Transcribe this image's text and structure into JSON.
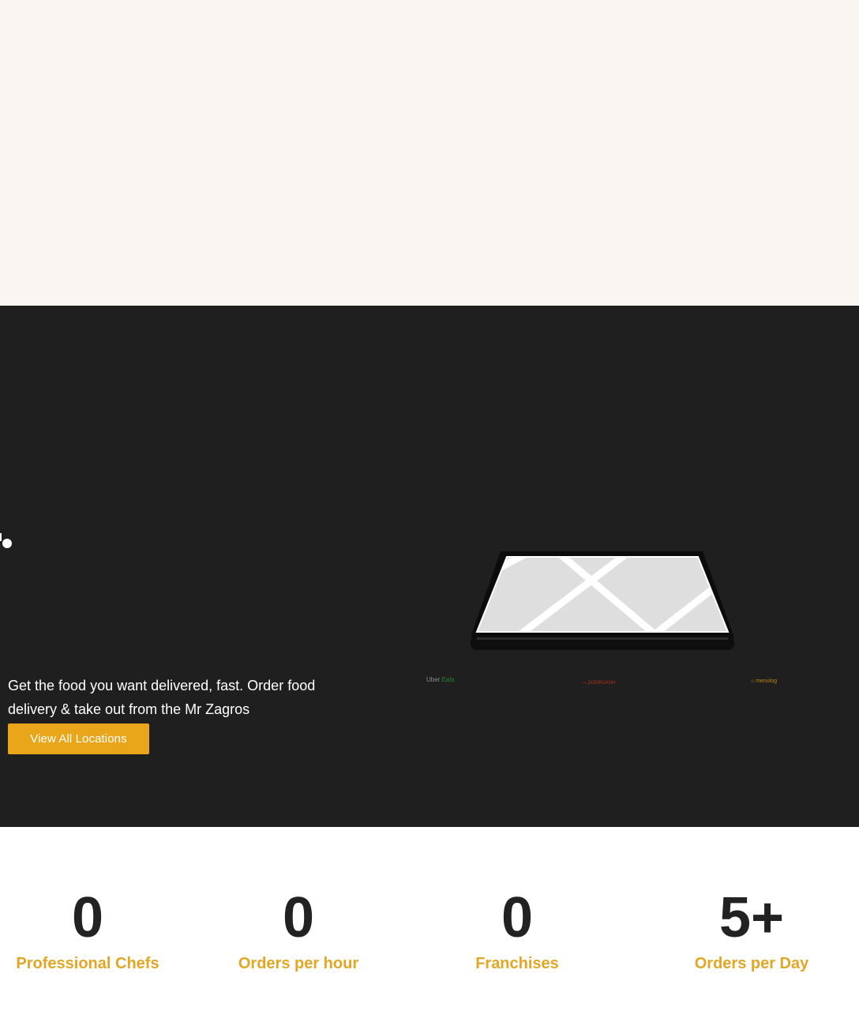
{
  "hero": {
    "intro_text": "Get the food you want delivered, fast. Order food delivery & take out from the Mr Zagros",
    "cta_label": "View All Locations"
  },
  "partners": {
    "uber_eats": {
      "part1": "Uber",
      "part2": "Eats"
    },
    "doordash": "DOORDASH",
    "menulog": "menulog"
  },
  "stats": [
    {
      "value": "0",
      "label": "Professional Chefs"
    },
    {
      "value": "0",
      "label": "Orders per hour"
    },
    {
      "value": "0",
      "label": "Franchises"
    },
    {
      "value": "5+",
      "label": "Orders per Day"
    }
  ],
  "colors": {
    "top_background": "#f9f6f1",
    "dark_background": "#1f1f1f",
    "accent": "#eaa61a",
    "stat_number": "#222222",
    "stat_label": "#e3a624"
  }
}
